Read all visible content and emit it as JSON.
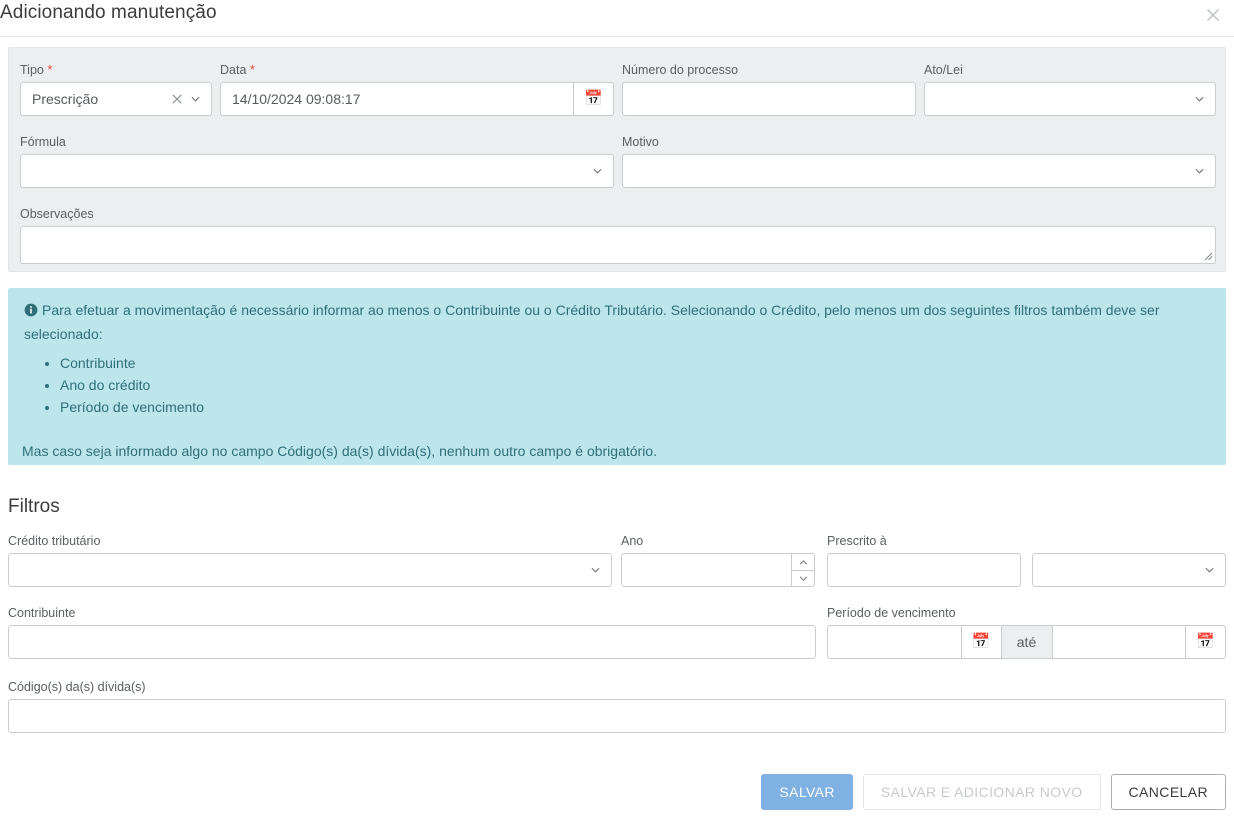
{
  "header": {
    "title": "Adicionando manutenção",
    "close_icon": "close-icon"
  },
  "form": {
    "tipo": {
      "label": "Tipo",
      "required": "*",
      "value": "Prescrição",
      "clear_icon": "clear-x-icon",
      "chevron_icon": "chevron-down-icon"
    },
    "data": {
      "label": "Data",
      "required": "*",
      "value": "14/10/2024 09:08:17",
      "calendar_icon": "📅"
    },
    "numero_processo": {
      "label": "Número do processo",
      "value": ""
    },
    "ato_lei": {
      "label": "Ato/Lei",
      "value": "",
      "chevron_icon": "chevron-down-icon"
    },
    "formula": {
      "label": "Fórmula",
      "value": "",
      "chevron_icon": "chevron-down-icon"
    },
    "motivo": {
      "label": "Motivo",
      "value": "",
      "chevron_icon": "chevron-down-icon"
    },
    "observacoes": {
      "label": "Observações",
      "value": ""
    }
  },
  "info": {
    "icon": "info-circle-icon",
    "lead": "Para efetuar a movimentação é necessário informar ao menos o Contribuinte ou o Crédito Tributário. Selecionando o Crédito, pelo menos um dos seguintes filtros também deve ser selecionado:",
    "bullets": [
      "Contribuinte",
      "Ano do crédito",
      "Período de vencimento"
    ],
    "tail": "Mas caso seja informado algo no campo Código(s) da(s) dívida(s), nenhum outro campo é obrigatório."
  },
  "filters": {
    "title": "Filtros",
    "credito_tributario": {
      "label": "Crédito tributário",
      "value": "",
      "chevron_icon": "chevron-down-icon"
    },
    "ano": {
      "label": "Ano",
      "value": "",
      "up_icon": "chevron-up-icon",
      "down_icon": "chevron-down-icon"
    },
    "prescrito_a": {
      "label": "Prescrito à",
      "value": ""
    },
    "prescrito_a_select": {
      "value": "",
      "chevron_icon": "chevron-down-icon"
    },
    "contribuinte": {
      "label": "Contribuinte",
      "value": ""
    },
    "periodo_vencimento": {
      "label": "Período de vencimento",
      "start_value": "",
      "start_calendar_icon": "📅",
      "separator": "até",
      "end_value": "",
      "end_calendar_icon": "📅"
    },
    "codigos_divida": {
      "label": "Código(s) da(s) dívida(s)",
      "value": ""
    }
  },
  "footer": {
    "save": "SALVAR",
    "save_and_new": "SALVAR E ADICIONAR NOVO",
    "cancel": "CANCELAR"
  },
  "colors": {
    "primary": "#7fb1e2",
    "info_bg": "#bde5ec",
    "info_text": "#2f6f7a",
    "panel_bg": "#eceeef",
    "required": "#e24a3b"
  }
}
